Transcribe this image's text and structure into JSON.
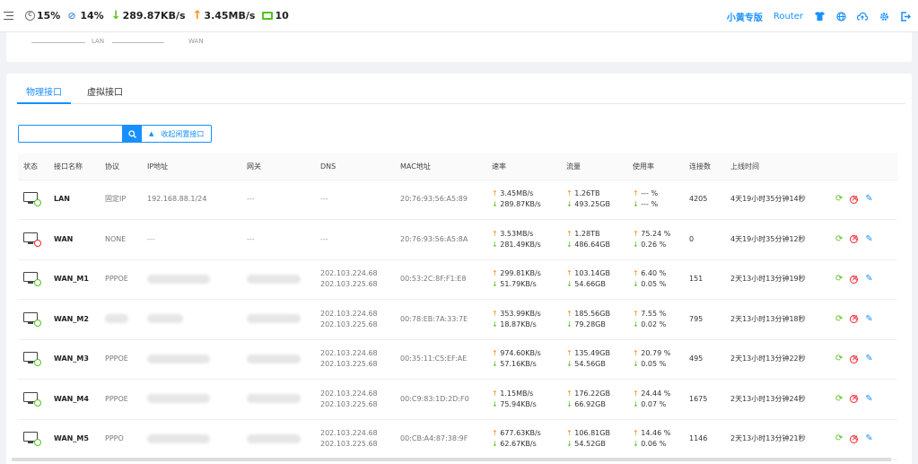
{
  "top": {
    "cpu": "15%",
    "mem": "14%",
    "down_speed": "289.87KB/s",
    "up_speed": "3.45MB/s",
    "devices": "10",
    "brand": "小黄专版",
    "router": "Router"
  },
  "legend": {
    "lan": "LAN",
    "wan": "WAN"
  },
  "tabs": {
    "physical": "物理接口",
    "virtual": "虚拟接口"
  },
  "toolbar": {
    "search_placeholder": "",
    "collapse_label": "收起闲置接口"
  },
  "table": {
    "headers": [
      "状态",
      "接口名称",
      "协议",
      "IP地址",
      "网关",
      "DNS",
      "MAC地址",
      "速率",
      "流量",
      "使用率",
      "连接数",
      "上线时间"
    ],
    "rows": [
      {
        "name": "LAN",
        "proto": "固定IP",
        "ip": "192.168.88.1/24",
        "gw": "---",
        "dns1": "---",
        "dns2": "",
        "mac": "20:76:93:56:A5:89",
        "up": "3.45MB/s",
        "down": "289.87KB/s",
        "tx": "1.26TB",
        "rx": "493.25GB",
        "use_up": "--- %",
        "use_dn": "--- %",
        "conn": "4205",
        "uptime": "4天19小时35分钟14秒",
        "online": true
      },
      {
        "name": "WAN",
        "proto": "NONE",
        "ip": "---",
        "gw": "---",
        "dns1": "---",
        "dns2": "",
        "mac": "20:76:93:56:A5:8A",
        "up": "3.53MB/s",
        "down": "281.49KB/s",
        "tx": "1.28TB",
        "rx": "486.64GB",
        "use_up": "75.24 %",
        "use_dn": "0.26 %",
        "conn": "0",
        "uptime": "4天19小时35分钟12秒",
        "online": false
      },
      {
        "name": "WAN_M1",
        "proto": "PPPOE",
        "ip": "",
        "gw": "",
        "dns1": "202.103.224.68",
        "dns2": "202.103.225.68",
        "mac": "00:53:2C:8F:F1:E8",
        "up": "299.81KB/s",
        "down": "51.79KB/s",
        "tx": "103.14GB",
        "rx": "54.66GB",
        "use_up": "6.40 %",
        "use_dn": "0.05 %",
        "conn": "151",
        "uptime": "2天13小时13分钟19秒",
        "online": true
      },
      {
        "name": "WAN_M2",
        "proto": "",
        "ip": "",
        "gw": "",
        "dns1": "202.103.224.68",
        "dns2": "202.103.225.68",
        "mac": "00:78:EB:7A:33:7E",
        "up": "353.99KB/s",
        "down": "18.87KB/s",
        "tx": "185.56GB",
        "rx": "79.28GB",
        "use_up": "7.55 %",
        "use_dn": "0.02 %",
        "conn": "795",
        "uptime": "2天13小时13分钟18秒",
        "online": true
      },
      {
        "name": "WAN_M3",
        "proto": "PPPOE",
        "ip": "",
        "gw": "",
        "dns1": "202.103.224.68",
        "dns2": "202.103.225.68",
        "mac": "00:35:11:C5:EF:AE",
        "up": "974.60KB/s",
        "down": "57.16KB/s",
        "tx": "135.49GB",
        "rx": "54.56GB",
        "use_up": "20.79 %",
        "use_dn": "0.05 %",
        "conn": "495",
        "uptime": "2天13小时13分钟22秒",
        "online": true
      },
      {
        "name": "WAN_M4",
        "proto": "PPPOE",
        "ip": "",
        "gw": "",
        "dns1": "202.103.224.68",
        "dns2": "202.103.225.68",
        "mac": "00:C9:83:1D:2D:F0",
        "up": "1.15MB/s",
        "down": "75.94KB/s",
        "tx": "176.22GB",
        "rx": "66.92GB",
        "use_up": "24.44 %",
        "use_dn": "0.07 %",
        "conn": "1675",
        "uptime": "2天13小时13分钟24秒",
        "online": true
      },
      {
        "name": "WAN_M5",
        "proto": "PPPO",
        "ip": "",
        "gw": "",
        "dns1": "202.103.224.68",
        "dns2": "202.103.225.68",
        "mac": "00:CB:A4:87:38:9F",
        "up": "677.63KB/s",
        "down": "62.67KB/s",
        "tx": "106.81GB",
        "rx": "54.52GB",
        "use_up": "14.46 %",
        "use_dn": "0.06 %",
        "conn": "1146",
        "uptime": "2天13小时13分钟21秒",
        "online": true
      }
    ]
  },
  "colors": {
    "accent": "#1890ff",
    "up": "#fa8c16",
    "down": "#52c41a",
    "error": "#f5222d"
  }
}
